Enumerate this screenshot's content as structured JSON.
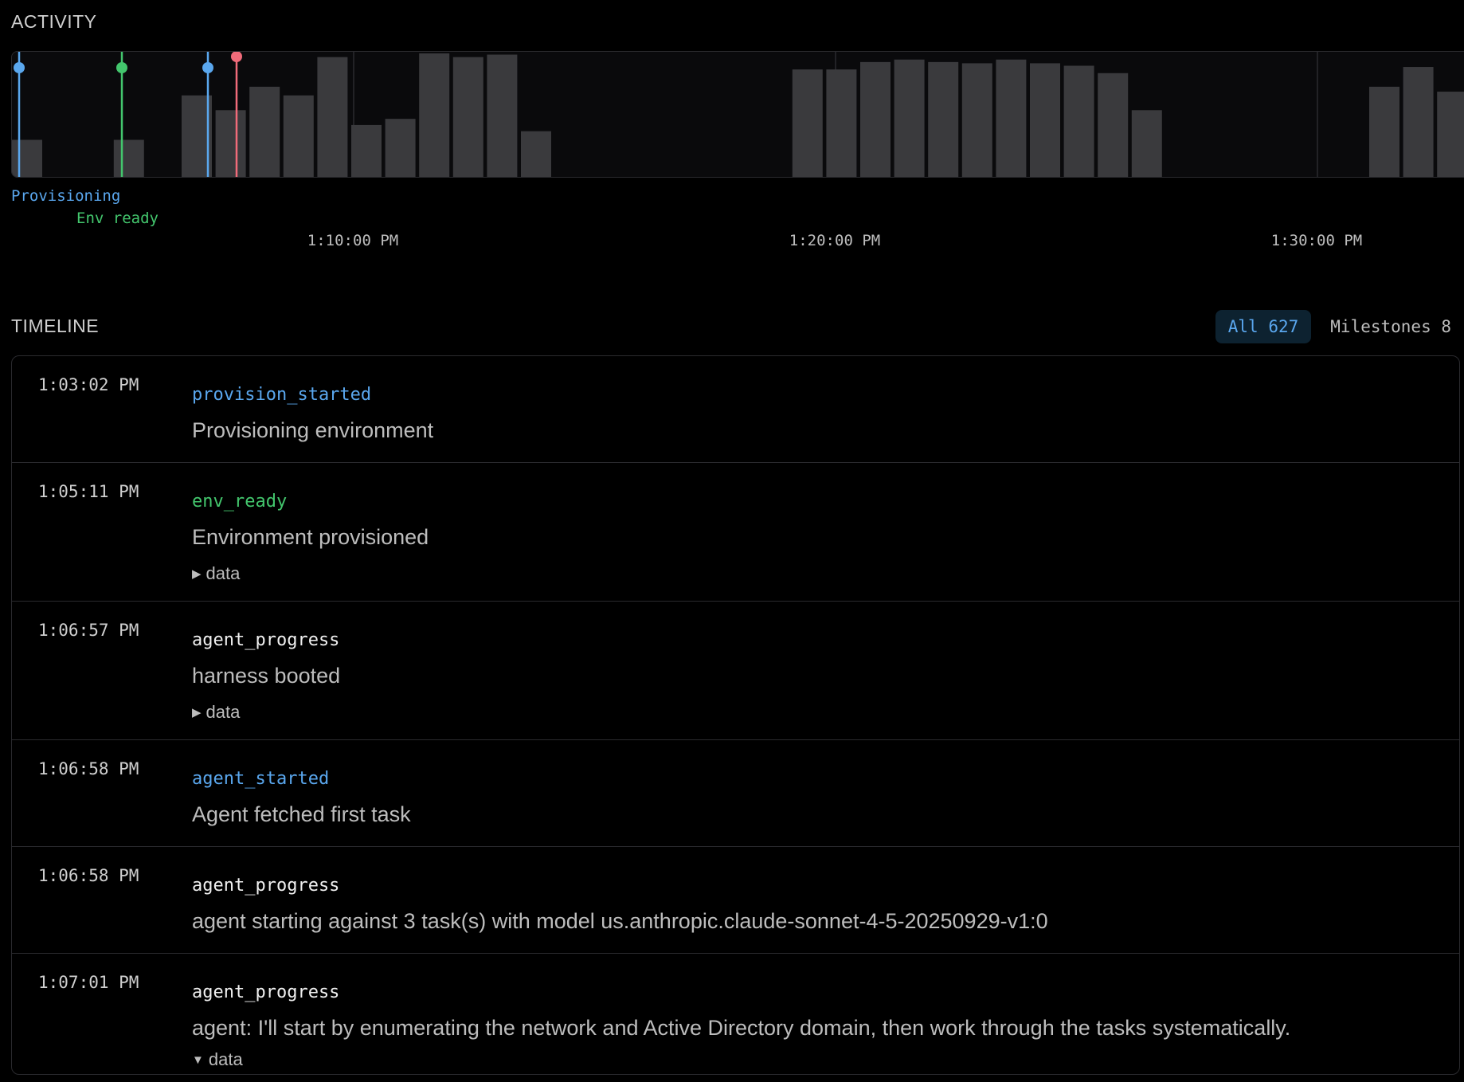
{
  "activity": {
    "title": "ACTIVITY",
    "markers": [
      {
        "label": "Provisioning",
        "color": "#5aa7ee"
      },
      {
        "label": "Env ready",
        "color": "#43c66d"
      }
    ],
    "ticks": [
      "1:10:00 PM",
      "1:20:00 PM",
      "1:30:00 PM"
    ],
    "bar_heights": [
      0.3,
      0,
      0,
      0.3,
      0,
      0.66,
      0.54,
      0.73,
      0.66,
      0.97,
      0.42,
      0.47,
      1.0,
      0.97,
      0.99,
      0.37,
      0,
      0,
      0,
      0,
      0,
      0,
      0,
      0.87,
      0.87,
      0.93,
      0.95,
      0.93,
      0.92,
      0.95,
      0.92,
      0.9,
      0.84,
      0.54,
      0,
      0,
      0,
      0,
      0,
      0,
      0.73,
      0.89,
      0.69
    ],
    "bar_color": "#3a3a3d"
  },
  "timeline": {
    "title": "TIMELINE",
    "filters": {
      "all_label": "All 627",
      "milestones_label": "Milestones 8"
    },
    "rows": [
      {
        "time": "1:03:02 PM",
        "event": "provision_started",
        "event_color": "blue",
        "message": "Provisioning environment",
        "toggle": ""
      },
      {
        "time": "1:05:11 PM",
        "event": "env_ready",
        "event_color": "green",
        "message": "Environment provisioned",
        "toggle": "data"
      },
      {
        "time": "1:06:57 PM",
        "event": "agent_progress",
        "event_color": "white",
        "message": "harness booted",
        "toggle": "data"
      },
      {
        "time": "1:06:58 PM",
        "event": "agent_started",
        "event_color": "blue",
        "message": "Agent fetched first task",
        "toggle": ""
      },
      {
        "time": "1:06:58 PM",
        "event": "agent_progress",
        "event_color": "white",
        "message": "agent starting against 3 task(s) with model us.anthropic.claude-sonnet-4-5-20250929-v1:0",
        "toggle": ""
      },
      {
        "time": "1:07:01 PM",
        "event": "agent_progress",
        "event_color": "white",
        "message": "agent: I'll start by enumerating the network and Active Directory domain, then work through the tasks systematically.",
        "toggle": "data",
        "expanded": true
      }
    ]
  }
}
